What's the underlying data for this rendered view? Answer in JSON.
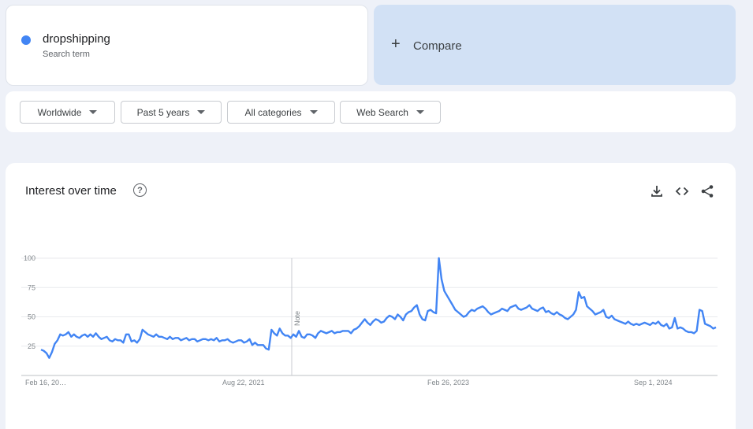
{
  "search_term": {
    "name": "dropshipping",
    "subtitle": "Search term",
    "color": "#4285f4"
  },
  "compare": {
    "plus": "+",
    "label": "Compare"
  },
  "filters": [
    {
      "label": "Worldwide"
    },
    {
      "label": "Past 5 years"
    },
    {
      "label": "All categories"
    },
    {
      "label": "Web Search"
    }
  ],
  "interest_panel": {
    "title": "Interest over time",
    "help_icon": "question-mark-icon",
    "tools": [
      "download-icon",
      "embed-code-icon",
      "share-icon"
    ]
  },
  "chart_data": {
    "type": "line",
    "title": "Interest over time",
    "xlabel": "",
    "ylabel": "",
    "ylim": [
      0,
      100
    ],
    "y_ticks": [
      25,
      50,
      75,
      100
    ],
    "x_tick_labels": [
      "Feb 16, 20…",
      "Aug 22, 2021",
      "Feb 26, 2023",
      "Sep 1, 2024"
    ],
    "note_label": "Note",
    "grid": true,
    "line_color": "#4285f4",
    "series": [
      {
        "name": "dropshipping",
        "values": [
          22,
          21,
          19,
          15,
          20,
          27,
          30,
          35,
          34,
          35,
          37,
          33,
          35,
          33,
          32,
          34,
          35,
          33,
          35,
          33,
          36,
          33,
          31,
          32,
          33,
          30,
          29,
          31,
          30,
          30,
          28,
          35,
          35,
          29,
          30,
          28,
          31,
          39,
          37,
          35,
          34,
          33,
          35,
          33,
          33,
          32,
          31,
          33,
          31,
          32,
          32,
          30,
          31,
          32,
          30,
          31,
          31,
          29,
          30,
          31,
          31,
          30,
          31,
          30,
          32,
          29,
          30,
          30,
          31,
          29,
          28,
          29,
          30,
          30,
          28,
          29,
          31,
          26,
          28,
          26,
          26,
          26,
          23,
          22,
          39,
          36,
          34,
          40,
          36,
          34,
          34,
          32,
          35,
          33,
          38,
          33,
          32,
          35,
          35,
          34,
          32,
          36,
          38,
          37,
          36,
          37,
          38,
          36,
          37,
          37,
          38,
          38,
          38,
          36,
          39,
          40,
          42,
          45,
          48,
          45,
          43,
          46,
          48,
          47,
          45,
          46,
          49,
          51,
          50,
          48,
          52,
          50,
          47,
          52,
          54,
          55,
          58,
          60,
          52,
          48,
          47,
          55,
          56,
          54,
          53,
          100,
          82,
          72,
          68,
          64,
          60,
          56,
          54,
          52,
          50,
          51,
          54,
          56,
          55,
          57,
          58,
          59,
          57,
          54,
          52,
          53,
          54,
          55,
          57,
          56,
          55,
          58,
          59,
          60,
          57,
          56,
          57,
          58,
          60,
          57,
          56,
          55,
          57,
          58,
          54,
          55,
          53,
          52,
          54,
          52,
          51,
          49,
          48,
          50,
          52,
          56,
          71,
          66,
          67,
          59,
          57,
          55,
          52,
          53,
          54,
          56,
          50,
          49,
          51,
          48,
          47,
          46,
          45,
          44,
          46,
          44,
          43,
          44,
          43,
          44,
          45,
          44,
          43,
          45,
          44,
          46,
          43,
          42,
          44,
          40,
          41,
          49,
          40,
          41,
          40,
          38,
          37,
          37,
          36,
          38,
          56,
          55,
          44,
          43,
          42,
          40,
          41
        ]
      }
    ]
  }
}
